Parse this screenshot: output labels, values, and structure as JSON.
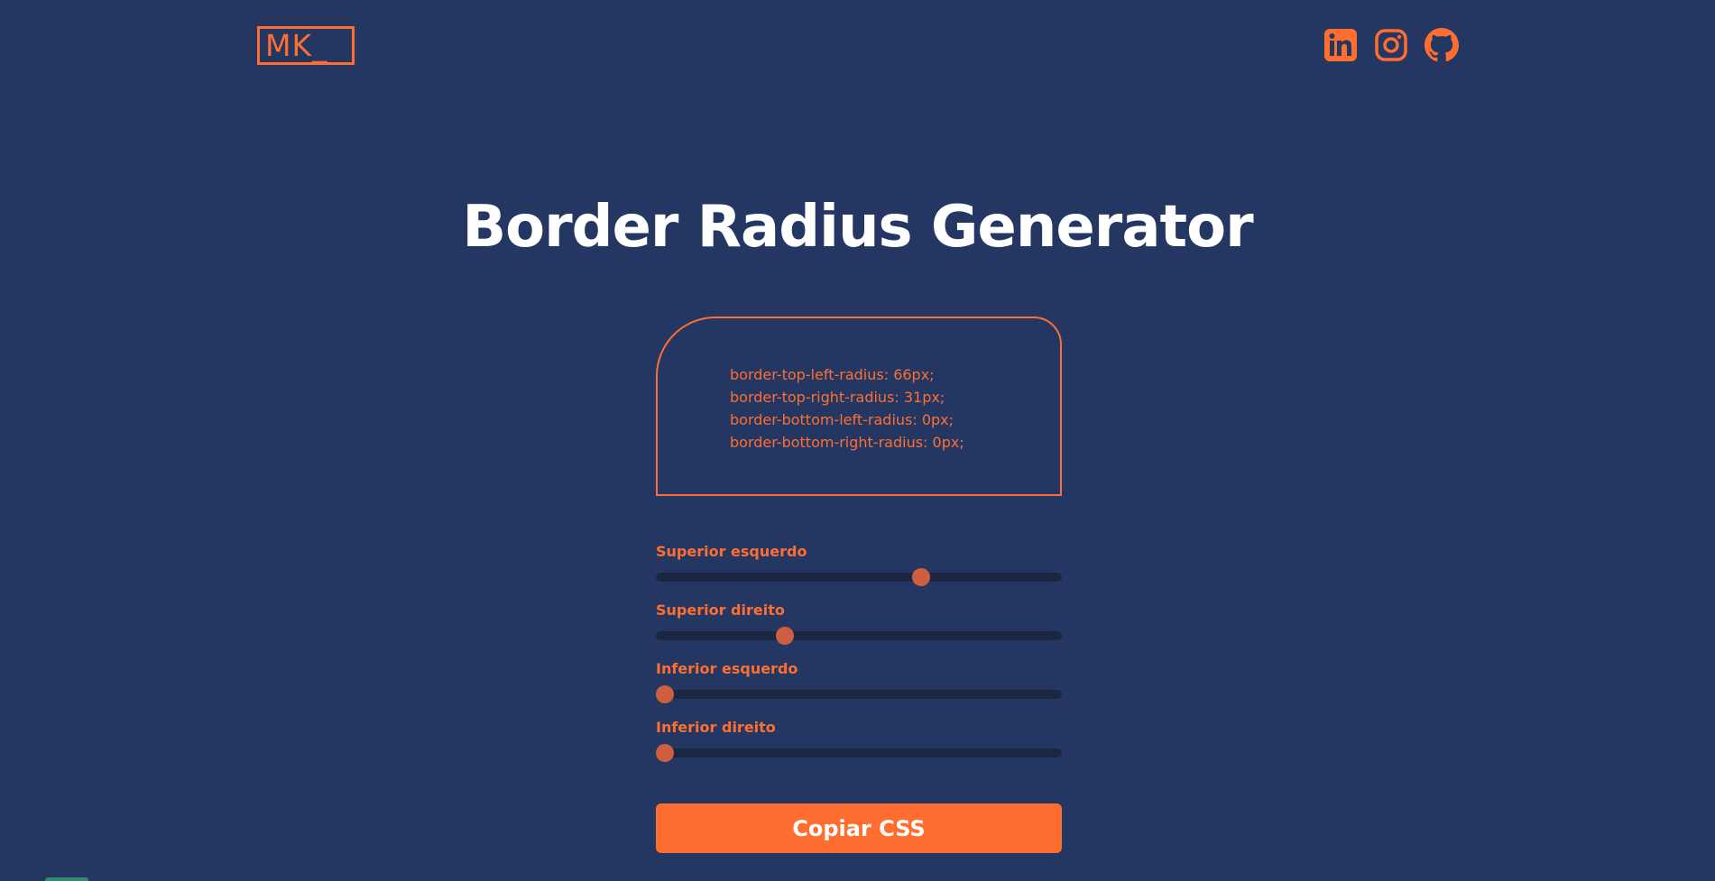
{
  "header": {
    "logo_text": "MK_",
    "social": [
      {
        "icon": "linkedin-icon"
      },
      {
        "icon": "instagram-icon"
      },
      {
        "icon": "github-icon"
      }
    ]
  },
  "main": {
    "title": "Border Radius Generator",
    "preview": {
      "css_lines": [
        "border-top-left-radius: 66px;",
        "border-top-right-radius: 31px;",
        "border-bottom-left-radius: 0px;",
        "border-bottom-right-radius: 0px;"
      ]
    },
    "controls": [
      {
        "label": "Superior esquerdo",
        "value": 66,
        "max": 100
      },
      {
        "label": "Superior direito",
        "value": 31,
        "max": 100
      },
      {
        "label": "Inferior esquerdo",
        "value": 0,
        "max": 100
      },
      {
        "label": "Inferior direito",
        "value": 0,
        "max": 100
      }
    ],
    "copy_button_label": "Copiar CSS"
  },
  "colors": {
    "background": "#243763",
    "accent": "#FF6E31",
    "slider_thumb": "#CD5F40",
    "slider_track": "#1B2643",
    "title": "#FFFFFF"
  }
}
